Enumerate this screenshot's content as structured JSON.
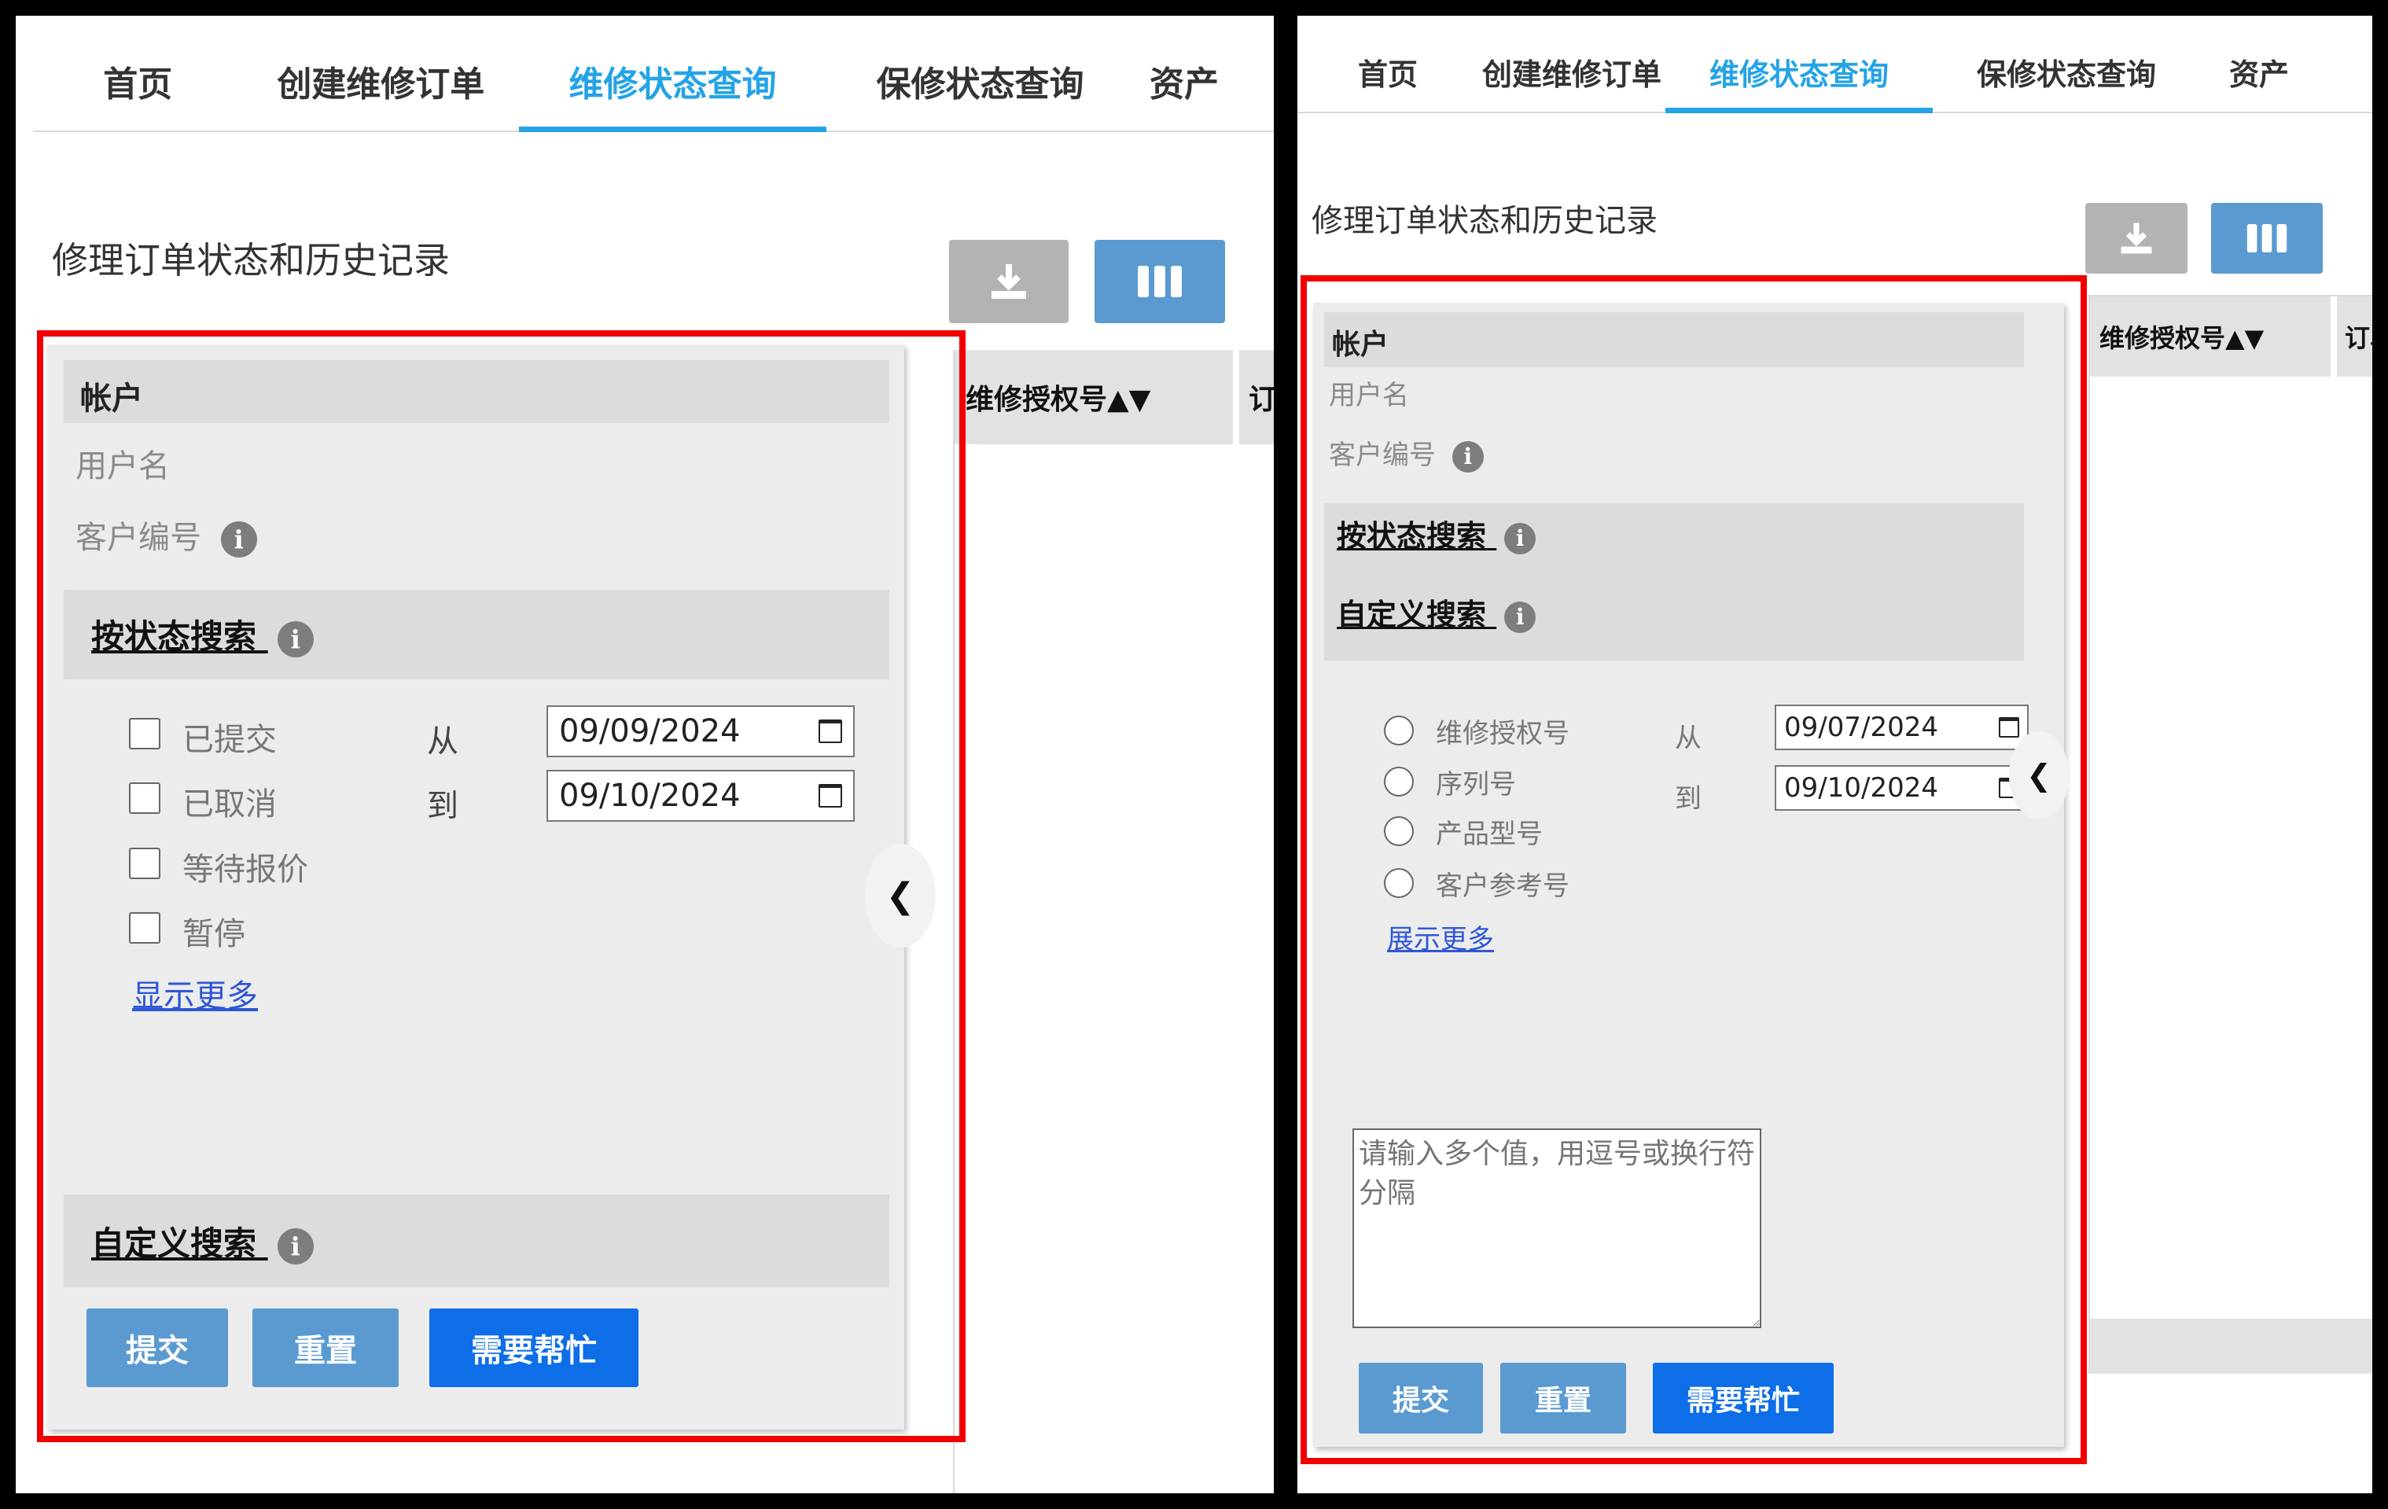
{
  "nav": {
    "tabs": [
      {
        "label": "首页"
      },
      {
        "label": "创建维修订单"
      },
      {
        "label": "维修状态查询"
      },
      {
        "label": "保修状态查询"
      },
      {
        "label": "资产"
      }
    ],
    "active_index": 2
  },
  "page_title": "修理订单状态和历史记录",
  "toolbar": {
    "download_icon": "download-icon",
    "columns_icon": "columns-icon"
  },
  "account": {
    "title": "帐户",
    "username_label": "用户名",
    "customer_id_label": "客户编号"
  },
  "search": {
    "by_status_label": "按状态搜索",
    "custom_label": "自定义搜索",
    "from_label": "从",
    "to_label": "到",
    "show_more_label": "显示更多",
    "show_more_label_right": "展示更多"
  },
  "left": {
    "statuses": [
      {
        "label": "已提交"
      },
      {
        "label": "已取消"
      },
      {
        "label": "等待报价"
      },
      {
        "label": "暂停"
      }
    ],
    "date_from": "09/09/2024",
    "date_to": "09/10/2024"
  },
  "right": {
    "options": [
      {
        "label": "维修授权号"
      },
      {
        "label": "序列号"
      },
      {
        "label": "产品型号"
      },
      {
        "label": "客户参考号"
      }
    ],
    "date_from": "09/07/2024",
    "date_to": "09/10/2024",
    "textarea_placeholder": "请输入多个值，用逗号或换行符分隔"
  },
  "buttons": {
    "submit": "提交",
    "reset": "重置",
    "help": "需要帮忙"
  },
  "table": {
    "col1": "维修授权号▲▼",
    "col2": "订单"
  },
  "colors": {
    "accent": "#24a3e6",
    "highlight": "#f10000",
    "primary_button": "#0d6ee8",
    "secondary_button": "#5a9ad1"
  }
}
